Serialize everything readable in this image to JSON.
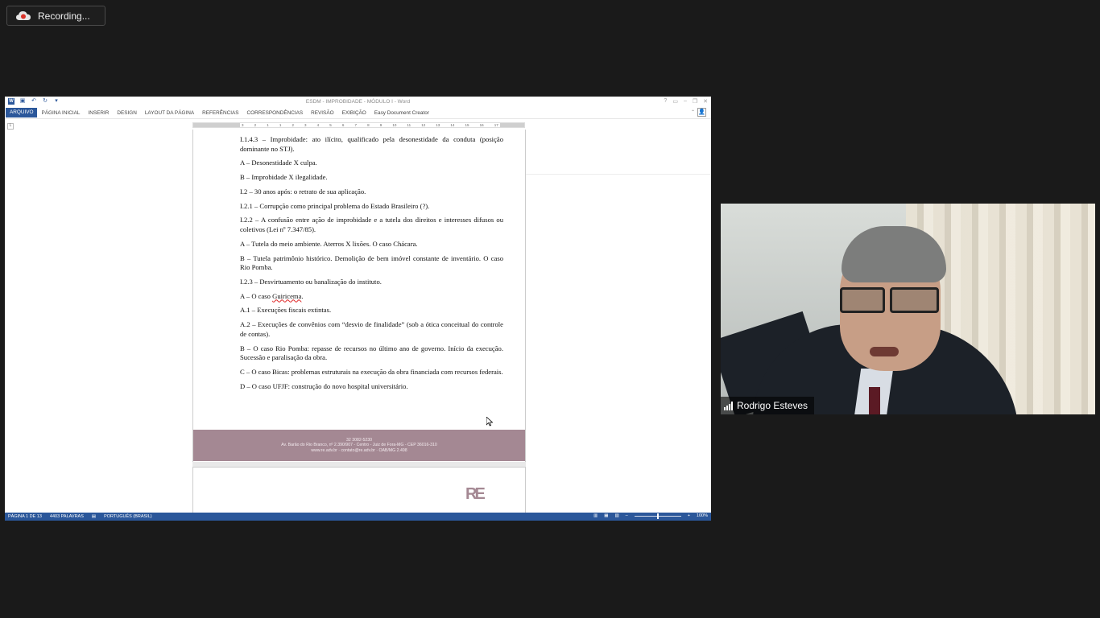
{
  "recording": {
    "label": "Recording..."
  },
  "word": {
    "title": "ESDM - IMPROBIDADE - MÓDULO I - Word",
    "ribbon_tabs": [
      "ARQUIVO",
      "PÁGINA INICIAL",
      "INSERIR",
      "DESIGN",
      "LAYOUT DA PÁGINA",
      "REFERÊNCIAS",
      "CORRESPONDÊNCIAS",
      "REVISÃO",
      "EXIBIÇÃO",
      "Easy Document Creator"
    ],
    "ruler_numbers": [
      "3",
      "2",
      "1",
      "1",
      "2",
      "3",
      "4",
      "5",
      "6",
      "7",
      "8",
      "9",
      "10",
      "11",
      "12",
      "13",
      "14",
      "15",
      "16",
      "17"
    ],
    "paragraphs": [
      "I.1.4.3 – Improbidade: ato ilícito, qualificado pela desonestidade da conduta (posição dominante no STJ).",
      "A – Desonestidade X culpa.",
      "B – Improbidade X ilegalidade.",
      "I.2 – 30 anos após: o retrato de sua aplicação.",
      "I.2.1 – Corrupção como principal problema do Estado Brasileiro (?).",
      "I.2.2 – A confusão entre ação de improbidade e a tutela dos direitos e interesses difusos ou coletivos (Lei nº 7.347/85).",
      "A – Tutela do meio ambiente. Aterros X lixões. O caso Chácara.",
      "B – Tutela patrimônio histórico. Demolição de bem imóvel constante de inventário. O caso Rio Pomba.",
      "I.2.3 – Desvirtuamento ou banalização do instituto."
    ],
    "guiricema_prefix": "A – O caso ",
    "guiricema_word": "Guiricema",
    "guiricema_suffix": ".",
    "paragraphs2": [
      "A.1 – Execuções fiscais extintas.",
      "A.2 – Execuções de convênios com “desvio de finalidade” (sob a ótica conceitual do controle de contas).",
      "B – O caso Rio Pomba: repasse de recursos no último ano de governo. Início da execução. Sucessão e paralisação da obra.",
      "C – O caso Bicas: problemas estruturais na execução da obra financiada com recursos federais.",
      "D – O caso UFJF: construção do novo hospital universitário."
    ],
    "footer_lines": [
      "32 3082-5230",
      "Av. Barão do Rio Branco, nº 2.390/907 - Centro - Juiz de Fora-MG - CEP 36016-310",
      "www.re.adv.br · contato@re.adv.br · OAB/MG 2.498"
    ],
    "page2_logo": "RE",
    "status": {
      "page": "PÁGINA 1 DE 13",
      "words": "4403 PALAVRAS",
      "language": "PORTUGUÊS (BRASIL)",
      "zoom": "100%"
    }
  },
  "participant": {
    "name": "Rodrigo Esteves"
  }
}
